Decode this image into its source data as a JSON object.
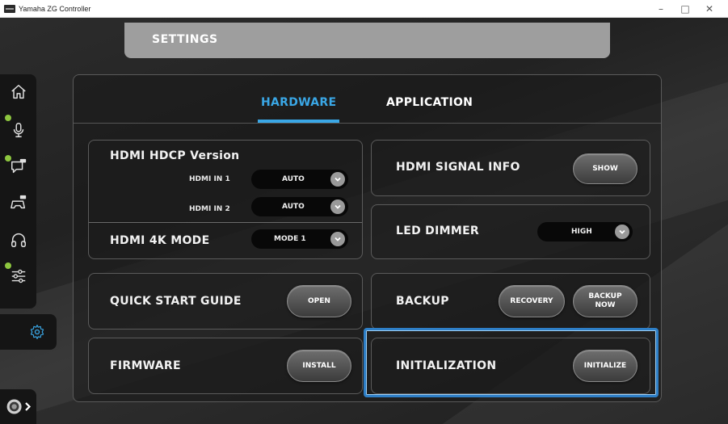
{
  "window": {
    "title": "Yamaha ZG Controller",
    "controls": {
      "minimize": "–",
      "maximize": "□",
      "close": "✕"
    }
  },
  "header": {
    "title": "SETTINGS"
  },
  "sidebar": {
    "items": [
      {
        "name": "home",
        "icon": "home-icon",
        "status_dot": false
      },
      {
        "name": "microphone",
        "icon": "microphone-icon",
        "status_dot": true
      },
      {
        "name": "chat-fx",
        "icon": "chat-fx-icon",
        "status_dot": true
      },
      {
        "name": "game-fx",
        "icon": "gamepad-fx-icon",
        "status_dot": false
      },
      {
        "name": "headphones",
        "icon": "headphones-icon",
        "status_dot": false
      },
      {
        "name": "mixer",
        "icon": "sliders-icon",
        "status_dot": true
      }
    ],
    "settings_icon": "gear-icon",
    "bottom_icon": "device-menu-icon"
  },
  "tabs": [
    {
      "label": "HARDWARE",
      "active": true
    },
    {
      "label": "APPLICATION",
      "active": false
    }
  ],
  "hdmi_hdcp": {
    "title": "HDMI HDCP Version",
    "in1_label": "HDMI IN 1",
    "in1_value": "AUTO",
    "in2_label": "HDMI IN 2",
    "in2_value": "AUTO"
  },
  "hdmi_4k": {
    "title": "HDMI 4K MODE",
    "value": "MODE 1"
  },
  "signal_info": {
    "title": "HDMI SIGNAL INFO",
    "button": "SHOW"
  },
  "led_dimmer": {
    "title": "LED DIMMER",
    "value": "HIGH"
  },
  "quick_start": {
    "title": "QUICK START GUIDE",
    "button": "OPEN"
  },
  "backup": {
    "title": "BACKUP",
    "recovery_button": "RECOVERY",
    "backup_now_line1": "BACKUP",
    "backup_now_line2": "NOW"
  },
  "firmware": {
    "title": "FIRMWARE",
    "button": "INSTALL"
  },
  "initialization": {
    "title": "INITIALIZATION",
    "button": "INITIALIZE"
  },
  "colors": {
    "accent": "#3aa7e6",
    "status_green": "#8dc63f",
    "highlight": "#2e7fc7"
  }
}
